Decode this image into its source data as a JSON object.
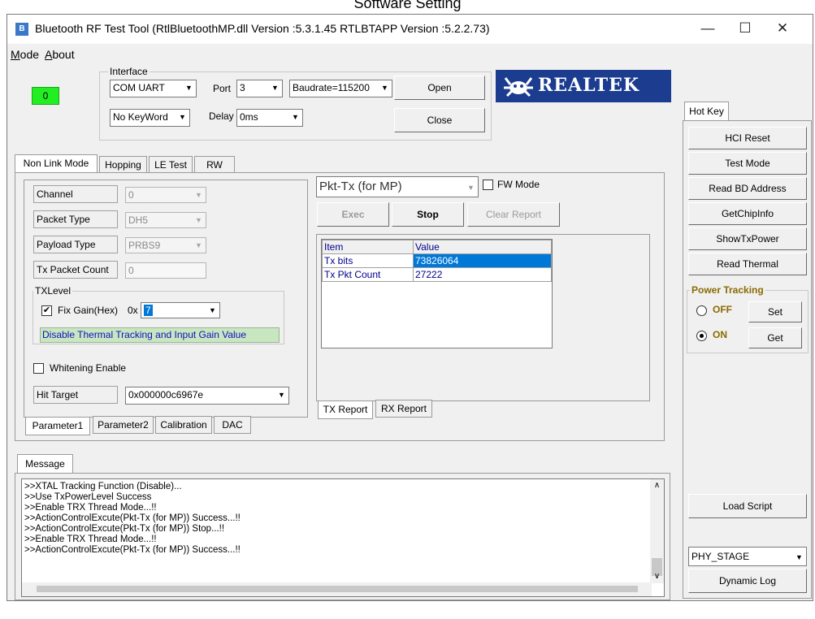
{
  "caption": "Software Setting",
  "window": {
    "title": "Bluetooth RF Test Tool (RtlBluetoothMP.dll Version :5.3.1.45   RTLBTAPP Version :5.2.2.73)",
    "controls": {
      "minimize": "—",
      "maximize": "☐",
      "close": "✕"
    }
  },
  "menu": {
    "mode": "Mode",
    "about": "About"
  },
  "status_indicator": {
    "value": "0",
    "color": "#22ee22"
  },
  "interface": {
    "title": "Interface",
    "port_type": "COM UART",
    "port_label": "Port",
    "port_value": "3",
    "baudrate": "Baudrate=115200",
    "open_label": "Open",
    "keyword": "No KeyWord",
    "delay_label": "Delay",
    "delay_value": "0ms",
    "close_label": "Close"
  },
  "brand": {
    "name": "REALTEK"
  },
  "main_tabs": [
    "Non Link Mode",
    "Hopping",
    "LE Test",
    "RW"
  ],
  "param": {
    "channel_label": "Channel",
    "channel_value": "0",
    "packet_type_label": "Packet Type",
    "packet_type_value": "DH5",
    "payload_type_label": "Payload Type",
    "payload_type_value": "PRBS9",
    "tx_packet_count_label": "Tx Packet Count",
    "tx_packet_count_value": "0",
    "txlevel_title": "TXLevel",
    "fix_gain_label": "Fix Gain(Hex)",
    "fix_gain_prefix": "0x",
    "fix_gain_value": "7",
    "thermal_note": "Disable Thermal Tracking and Input Gain Value",
    "whitening_label": "Whitening Enable",
    "hit_target_label": "Hit Target",
    "hit_target_value": "0x000000c6967e"
  },
  "bottom_tabs": [
    "Parameter1",
    "Parameter2",
    "Calibration",
    "DAC"
  ],
  "tx": {
    "mode": "Pkt-Tx (for MP)",
    "fw_mode_label": "FW Mode",
    "exec_label": "Exec",
    "stop_label": "Stop",
    "clear_label": "Clear Report",
    "table_headers": [
      "Item",
      "Value"
    ],
    "rows": [
      {
        "item": "Tx bits",
        "value": "73826064"
      },
      {
        "item": "Tx Pkt Count",
        "value": "27222"
      }
    ],
    "report_tabs": [
      "TX Report",
      "RX Report"
    ]
  },
  "hotkey": {
    "tab": "Hot Key",
    "buttons": [
      "HCI Reset",
      "Test Mode",
      "Read BD Address",
      "GetChipInfo",
      "ShowTxPower",
      "Read Thermal"
    ],
    "power_tracking": {
      "title": "Power Tracking",
      "off_label": "OFF",
      "on_label": "ON",
      "set_label": "Set",
      "get_label": "Get",
      "title_color": "#8b6a00"
    },
    "load_script": "Load Script",
    "stage": "PHY_STAGE",
    "dynamic_log": "Dynamic Log"
  },
  "message": {
    "tab": "Message",
    "lines": [
      ">>XTAL Tracking Function (Disable)...",
      ">>Use TxPowerLevel Success",
      ">>Enable TRX Thread Mode...!!",
      ">>ActionControlExcute(Pkt-Tx (for MP)) Success...!!",
      ">>ActionControlExcute(Pkt-Tx (for MP)) Stop...!!",
      ">>Enable TRX Thread Mode...!!",
      ">>ActionControlExcute(Pkt-Tx (for MP)) Success...!!"
    ]
  }
}
